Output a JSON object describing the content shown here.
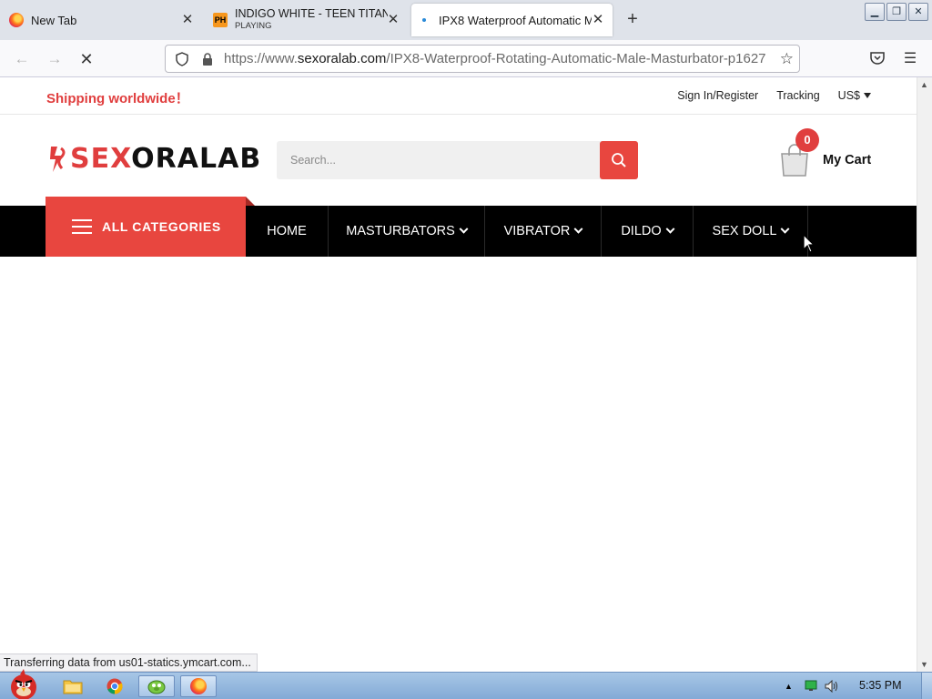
{
  "browser": {
    "tabs": [
      {
        "title": "New Tab",
        "favicon": "firefox-icon"
      },
      {
        "title": "INDIGO WHITE - TEEN TITANS",
        "subtitle": "PLAYING",
        "favicon": "ph-icon",
        "favicon_text": "PH"
      },
      {
        "title": "IPX8 Waterproof Automatic M",
        "favicon": "loading-icon",
        "active": true
      }
    ],
    "url": {
      "prefix": "https://www.",
      "domain": "sexoralab.com",
      "path": "/IPX8-Waterproof-Rotating-Automatic-Male-Masturbator-p1627"
    }
  },
  "site": {
    "shipping": "Shipping worldwide！",
    "toplinks": {
      "signin": "Sign In/Register",
      "tracking": "Tracking",
      "currency": "US$"
    },
    "logo": {
      "part1": "SEX",
      "part2": "ORALAB"
    },
    "search": {
      "placeholder": "Search..."
    },
    "cart": {
      "count": "0",
      "label": "My Cart"
    },
    "all_categories": "ALL CATEGORIES",
    "menu": [
      {
        "label": "HOME",
        "dropdown": false
      },
      {
        "label": "MASTURBATORS",
        "dropdown": true
      },
      {
        "label": "VIBRATOR",
        "dropdown": true
      },
      {
        "label": "DILDO",
        "dropdown": true
      },
      {
        "label": "SEX DOLL",
        "dropdown": true
      }
    ],
    "colors": {
      "accent": "#e8463f",
      "nav_bg": "#000000"
    }
  },
  "status_bar": "Transferring data from us01-statics.ymcart.com...",
  "taskbar": {
    "clock": "5:35 PM",
    "apps": [
      "angry-birds-icon",
      "explorer-icon",
      "chrome-icon",
      "game-icon",
      "firefox-icon"
    ]
  }
}
